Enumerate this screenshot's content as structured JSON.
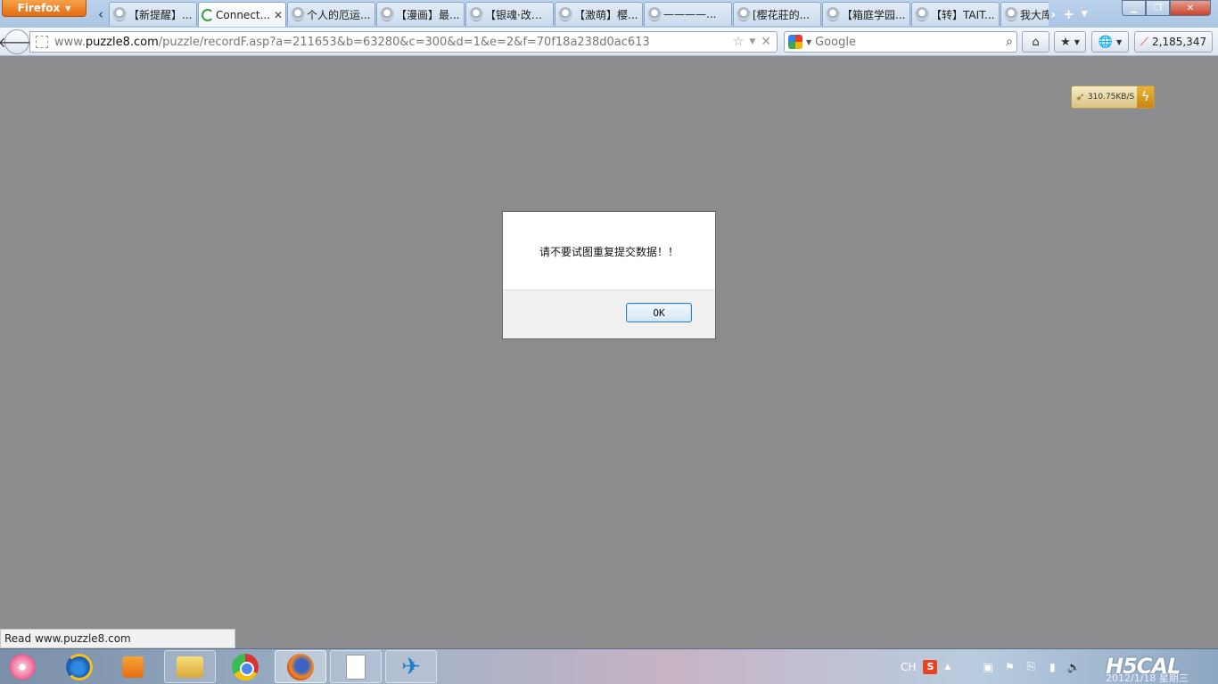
{
  "browser": {
    "menu_button": "Firefox",
    "tabs": [
      {
        "label": "【新提醒】...",
        "selected": false,
        "loading": false,
        "closable": false
      },
      {
        "label": "Connect...",
        "selected": true,
        "loading": true,
        "closable": true
      },
      {
        "label": "个人的厄运...",
        "selected": false,
        "loading": false,
        "closable": false
      },
      {
        "label": "【漫画】最...",
        "selected": false,
        "loading": false,
        "closable": false
      },
      {
        "label": "【银魂·改】...",
        "selected": false,
        "loading": false,
        "closable": false
      },
      {
        "label": "【激萌】樱...",
        "selected": false,
        "loading": false,
        "closable": false
      },
      {
        "label": "————...",
        "selected": false,
        "loading": false,
        "closable": false
      },
      {
        "label": "[樱花莊的...",
        "selected": false,
        "loading": false,
        "closable": false
      },
      {
        "label": "【箱庭学园...",
        "selected": false,
        "loading": false,
        "closable": false
      },
      {
        "label": "【转】TAIT...",
        "selected": false,
        "loading": false,
        "closable": false
      },
      {
        "label": "我大库存",
        "selected": false,
        "loading": false,
        "closable": false
      }
    ],
    "url": {
      "prefix": "www.",
      "domain": "puzzle8.com",
      "path": "/puzzle/recordF.asp?a=211653&b=63280&c=300&d=1&e=2&f=70f18a238d0ac613"
    },
    "search": {
      "engine": "Google",
      "placeholder": "Google"
    },
    "counter": "2,185,347"
  },
  "page": {
    "speed_badge": "310.75KB/S",
    "dialog": {
      "message": "请不要试图重复提交数据！！",
      "ok_label": "OK"
    },
    "status_text": "Read www.puzzle8.com"
  },
  "taskbar": {
    "language": "CH",
    "ime": "S",
    "wallpaper_logo": "H5CAL",
    "clock": "2012/1/18 星期三"
  },
  "icons": {
    "tab_favicon": "avatar-favicon-icon",
    "loading": "loading-spinner-icon",
    "back": "back-arrow-icon",
    "bookmark": "star-icon",
    "stop": "stop-icon",
    "search": "magnifier-icon",
    "home": "home-icon",
    "bookmarks_menu": "bookmarks-icon",
    "addon": "globe-icon",
    "speed": "lightning-icon"
  },
  "colors": {
    "firefox_button": "#e36b12",
    "page_overlay": "#8c8c8e",
    "ok_border": "#3c7fb1"
  }
}
